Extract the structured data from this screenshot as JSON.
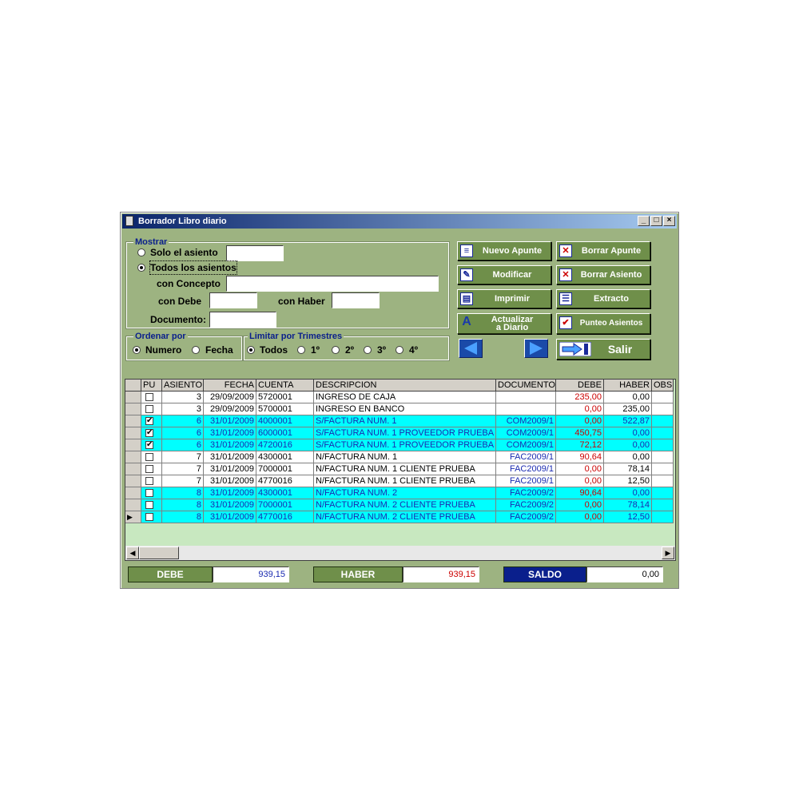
{
  "window": {
    "title": "Borrador Libro diario",
    "min": "_",
    "max": "□",
    "close": "×"
  },
  "mostrar": {
    "legend": "Mostrar",
    "solo_asiento": "Solo el asiento",
    "todos_asientos": "Todos los asientos",
    "con_concepto": "con Concepto",
    "con_debe": "con Debe",
    "con_haber": "con Haber",
    "documento": "Documento:",
    "selected": "todos"
  },
  "ordenar": {
    "legend": "Ordenar por",
    "numero": "Numero",
    "fecha": "Fecha",
    "selected": "numero"
  },
  "limitar": {
    "legend": "Limitar por Trimestres",
    "todos": "Todos",
    "q1": "1º",
    "q2": "2º",
    "q3": "3º",
    "q4": "4º",
    "selected": "todos"
  },
  "buttons": {
    "nuevo_apunte": "Nuevo Apunte",
    "borrar_apunte": "Borrar Apunte",
    "modificar": "Modificar",
    "borrar_asiento": "Borrar Asiento",
    "imprimir": "Imprimir",
    "extracto": "Extracto",
    "actualizar_1": "Actualizar",
    "actualizar_2": "a Diario",
    "punteo": "Punteo Asientos",
    "salir": "Salir"
  },
  "grid": {
    "columns": [
      "PU",
      "ASIENTO",
      "FECHA",
      "CUENTA",
      "DESCRIPCION",
      "DOCUMENTO",
      "DEBE",
      "HABER",
      "OBS"
    ],
    "rows": [
      {
        "pu": false,
        "asiento": "3",
        "fecha": "29/09/2009",
        "cuenta": "5720001",
        "descripcion": "INGRESO DE CAJA",
        "documento": "",
        "debe": "235,00",
        "haber": "0,00",
        "hl": false,
        "current": false
      },
      {
        "pu": false,
        "asiento": "3",
        "fecha": "29/09/2009",
        "cuenta": "5700001",
        "descripcion": "INGRESO EN BANCO",
        "documento": "",
        "debe": "0,00",
        "haber": "235,00",
        "hl": false,
        "current": false
      },
      {
        "pu": true,
        "asiento": "6",
        "fecha": "31/01/2009",
        "cuenta": "4000001",
        "descripcion": "S/FACTURA NUM. 1",
        "documento": "COM2009/1",
        "debe": "0,00",
        "haber": "522,87",
        "hl": true,
        "current": false
      },
      {
        "pu": true,
        "asiento": "6",
        "fecha": "31/01/2009",
        "cuenta": "6000001",
        "descripcion": "S/FACTURA NUM. 1 PROVEEDOR PRUEBA",
        "documento": "COM2009/1",
        "debe": "450,75",
        "haber": "0,00",
        "hl": true,
        "current": false
      },
      {
        "pu": true,
        "asiento": "6",
        "fecha": "31/01/2009",
        "cuenta": "4720016",
        "descripcion": "S/FACTURA NUM. 1 PROVEEDOR PRUEBA",
        "documento": "COM2009/1",
        "debe": "72,12",
        "haber": "0,00",
        "hl": true,
        "current": false
      },
      {
        "pu": false,
        "asiento": "7",
        "fecha": "31/01/2009",
        "cuenta": "4300001",
        "descripcion": "N/FACTURA NUM. 1",
        "documento": "FAC2009/1",
        "debe": "90,64",
        "haber": "0,00",
        "hl": false,
        "current": false
      },
      {
        "pu": false,
        "asiento": "7",
        "fecha": "31/01/2009",
        "cuenta": "7000001",
        "descripcion": "N/FACTURA NUM. 1 CLIENTE PRUEBA",
        "documento": "FAC2009/1",
        "debe": "0,00",
        "haber": "78,14",
        "hl": false,
        "current": false
      },
      {
        "pu": false,
        "asiento": "7",
        "fecha": "31/01/2009",
        "cuenta": "4770016",
        "descripcion": "N/FACTURA NUM. 1 CLIENTE PRUEBA",
        "documento": "FAC2009/1",
        "debe": "0,00",
        "haber": "12,50",
        "hl": false,
        "current": false
      },
      {
        "pu": false,
        "asiento": "8",
        "fecha": "31/01/2009",
        "cuenta": "4300001",
        "descripcion": "N/FACTURA NUM. 2",
        "documento": "FAC2009/2",
        "debe": "90,64",
        "haber": "0,00",
        "hl": true,
        "current": false
      },
      {
        "pu": false,
        "asiento": "8",
        "fecha": "31/01/2009",
        "cuenta": "7000001",
        "descripcion": "N/FACTURA NUM. 2 CLIENTE PRUEBA",
        "documento": "FAC2009/2",
        "debe": "0,00",
        "haber": "78,14",
        "hl": true,
        "current": false
      },
      {
        "pu": false,
        "asiento": "8",
        "fecha": "31/01/2009",
        "cuenta": "4770016",
        "descripcion": "N/FACTURA NUM. 2 CLIENTE PRUEBA",
        "documento": "FAC2009/2",
        "debe": "0,00",
        "haber": "12,50",
        "hl": true,
        "current": true
      }
    ]
  },
  "totals": {
    "debe_label": "DEBE",
    "debe_value": "939,15",
    "haber_label": "HABER",
    "haber_value": "939,15",
    "saldo_label": "SALDO",
    "saldo_value": "0,00"
  },
  "colors": {
    "window_bg": "#9db381",
    "button_bg": "#6f8f4a",
    "highlight_row": "#00ffff",
    "debe_text": "#cc0000",
    "doc_text": "#1a2ab0",
    "saldo_bg": "#0a1f8c"
  }
}
